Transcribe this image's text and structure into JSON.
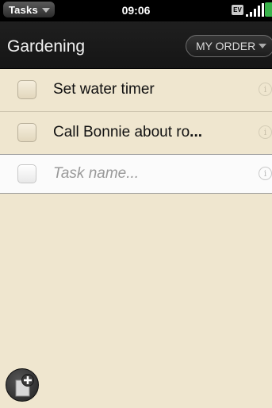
{
  "status_bar": {
    "app_name": "Tasks",
    "time": "09:06",
    "network": "EV"
  },
  "header": {
    "title": "Gardening",
    "sort_label": "MY ORDER"
  },
  "tasks": [
    {
      "title": "Set water timer",
      "completed": false
    },
    {
      "title": "Call Bonnie about ro",
      "ellipsis": "...",
      "completed": false
    }
  ],
  "new_task": {
    "placeholder": "Task name..."
  },
  "icons": {
    "info": "info-icon",
    "add": "add-task-icon",
    "signal": "signal-bars-icon",
    "battery": "battery-icon"
  },
  "colors": {
    "background": "#efe6cf",
    "header": "#1b1b1b",
    "battery": "#39b24a"
  }
}
